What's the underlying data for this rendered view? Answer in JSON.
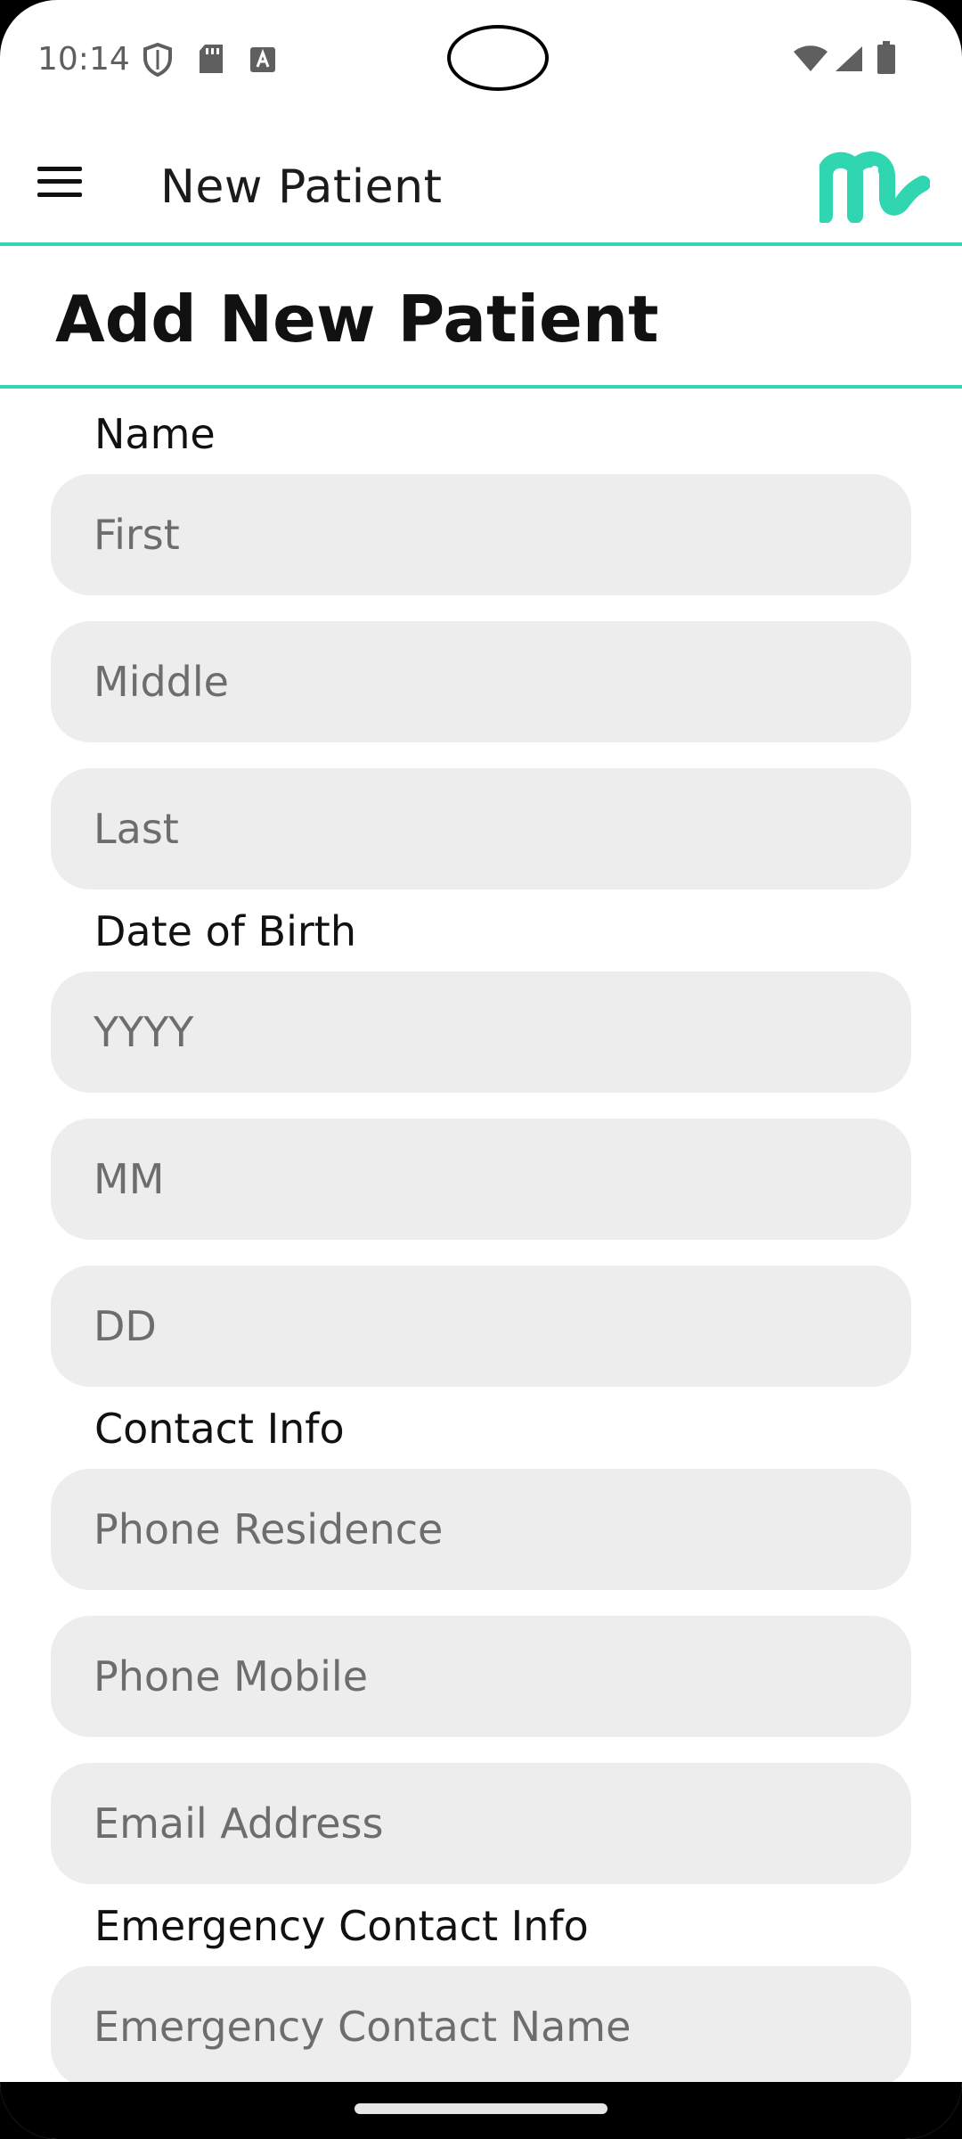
{
  "status_bar": {
    "time": "10:14"
  },
  "app_bar": {
    "title": "New Patient"
  },
  "heading": "Add New Patient",
  "form": {
    "name": {
      "label": "Name",
      "first_placeholder": "First",
      "middle_placeholder": "Middle",
      "last_placeholder": "Last"
    },
    "dob": {
      "label": "Date of Birth",
      "year_placeholder": "YYYY",
      "month_placeholder": "MM",
      "day_placeholder": "DD"
    },
    "contact": {
      "label": "Contact Info",
      "phone_residence_placeholder": "Phone Residence",
      "phone_mobile_placeholder": "Phone Mobile",
      "email_placeholder": "Email Address"
    },
    "emergency": {
      "label": "Emergency Contact Info",
      "name_placeholder": "Emergency Contact Name"
    }
  },
  "colors": {
    "accent": "#2fd6b0",
    "field_bg": "#ededed",
    "placeholder": "#6d6d6d"
  }
}
